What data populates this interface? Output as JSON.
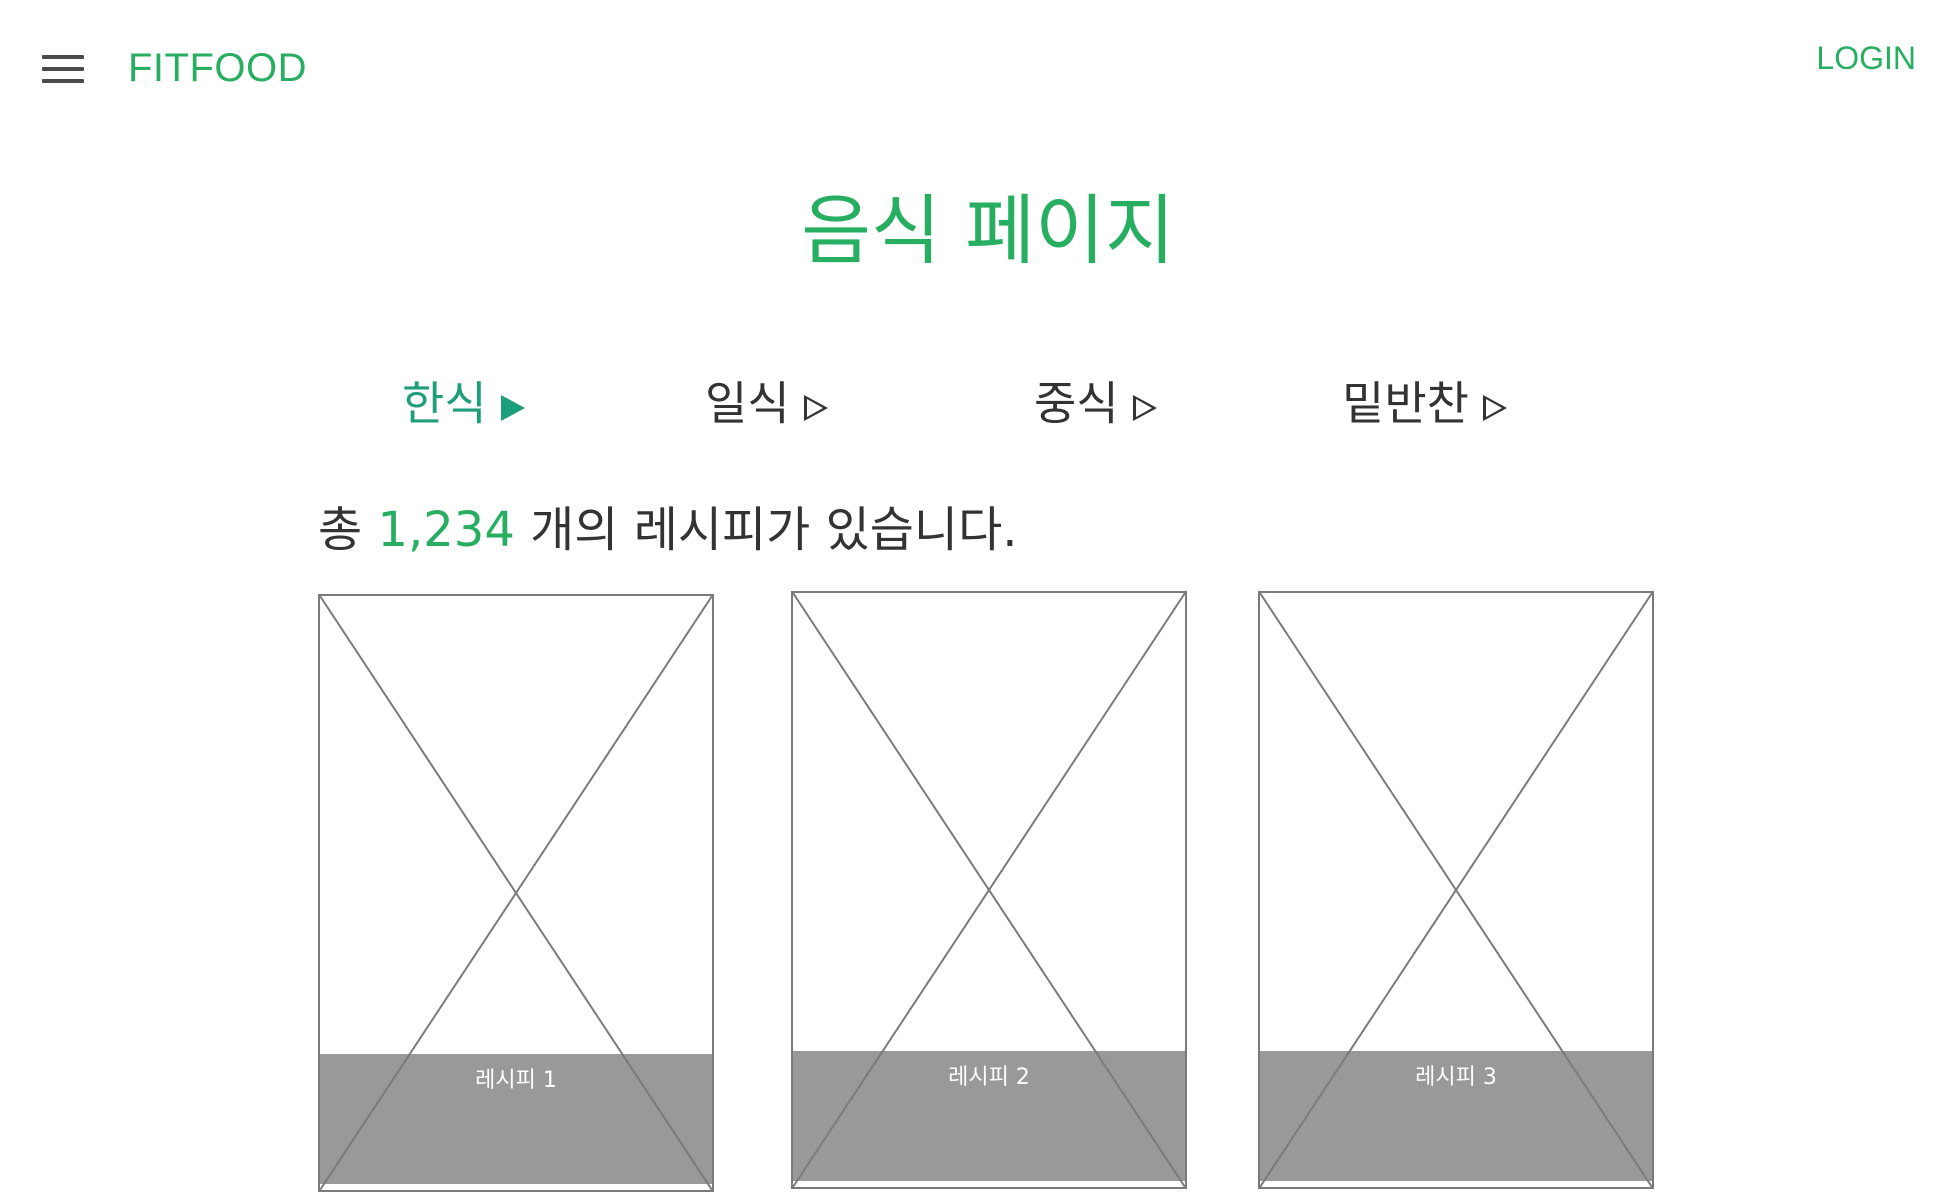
{
  "header": {
    "menu_icon": "hamburger-menu-icon",
    "logo": "FITFOOD",
    "login": "LOGIN"
  },
  "page_title": "음식 페이지",
  "tabs": [
    {
      "label": "한식",
      "arrow": "filled-play-icon",
      "active": true
    },
    {
      "label": "일식",
      "arrow": "outline-play-icon",
      "active": false
    },
    {
      "label": "중식",
      "arrow": "outline-play-icon",
      "active": false
    },
    {
      "label": "밑반찬",
      "arrow": "outline-play-icon",
      "active": false
    }
  ],
  "count_line": {
    "prefix": "총",
    "count": "1,234",
    "suffix": "개의 레시피가 있습니다."
  },
  "recipes": [
    {
      "caption": "레시피 1",
      "image": "image-placeholder"
    },
    {
      "caption": "레시피 2",
      "image": "image-placeholder"
    },
    {
      "caption": "레시피 3",
      "image": "image-placeholder"
    }
  ],
  "colors": {
    "brand": "#27ae60",
    "active_tab": "#1e9e7a",
    "text": "#333333",
    "caption_bg": "#999999",
    "placeholder_line": "#7a7a7a"
  }
}
